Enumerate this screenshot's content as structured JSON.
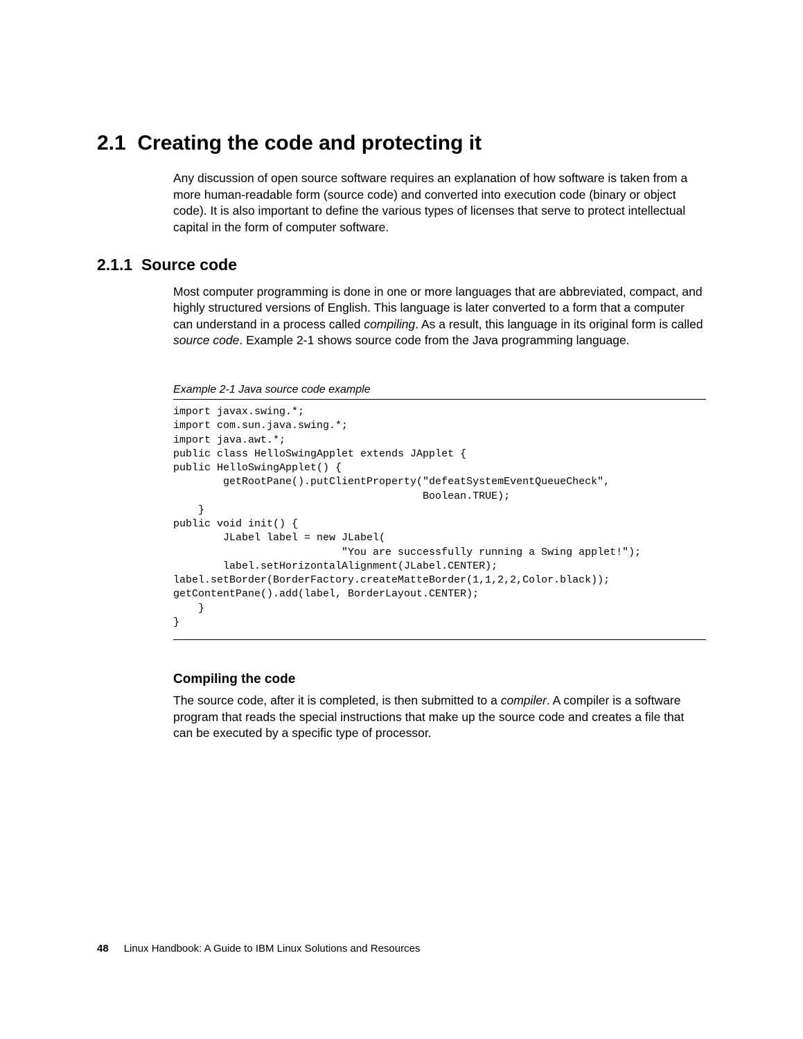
{
  "section": {
    "number": "2.1",
    "title": "Creating the code and protecting it",
    "intro": "Any discussion of open source software requires an explanation of how software is taken from a more human-readable form (source code) and converted into execution code (binary or object code). It is also important to define the various types of licenses that serve to protect intellectual capital in the form of computer software."
  },
  "subsection": {
    "number": "2.1.1",
    "title": "Source code",
    "p1a": "Most computer programming is done in one or more languages that are abbreviated, compact, and highly structured versions of English. This language is later converted to a form that a computer can understand in a process called ",
    "p1b": "compiling",
    "p1c": ". As a result, this language in its original form is called ",
    "p1d": "source code",
    "p1e": ". Example 2-1 shows source code from the Java programming language."
  },
  "example": {
    "caption": "Example 2-1   Java source code example",
    "code": "import javax.swing.*;\nimport com.sun.java.swing.*;\nimport java.awt.*;\npublic class HelloSwingApplet extends JApplet {\npublic HelloSwingApplet() {\n        getRootPane().putClientProperty(\"defeatSystemEventQueueCheck\",\n                                        Boolean.TRUE);\n    }\npublic void init() {\n        JLabel label = new JLabel(\n                           \"You are successfully running a Swing applet!\");\n        label.setHorizontalAlignment(JLabel.CENTER);\nlabel.setBorder(BorderFactory.createMatteBorder(1,1,2,2,Color.black));\ngetContentPane().add(label, BorderLayout.CENTER);\n    }\n}"
  },
  "compiling": {
    "heading": "Compiling the code",
    "p1a": "The source code, after it is completed, is then submitted to a ",
    "p1b": "compiler",
    "p1c": ". A compiler is a software program that reads the special instructions that make up the source code and creates a file that can be executed by a specific type of processor."
  },
  "footer": {
    "page": "48",
    "title": "Linux Handbook: A Guide to IBM Linux Solutions and Resources"
  }
}
